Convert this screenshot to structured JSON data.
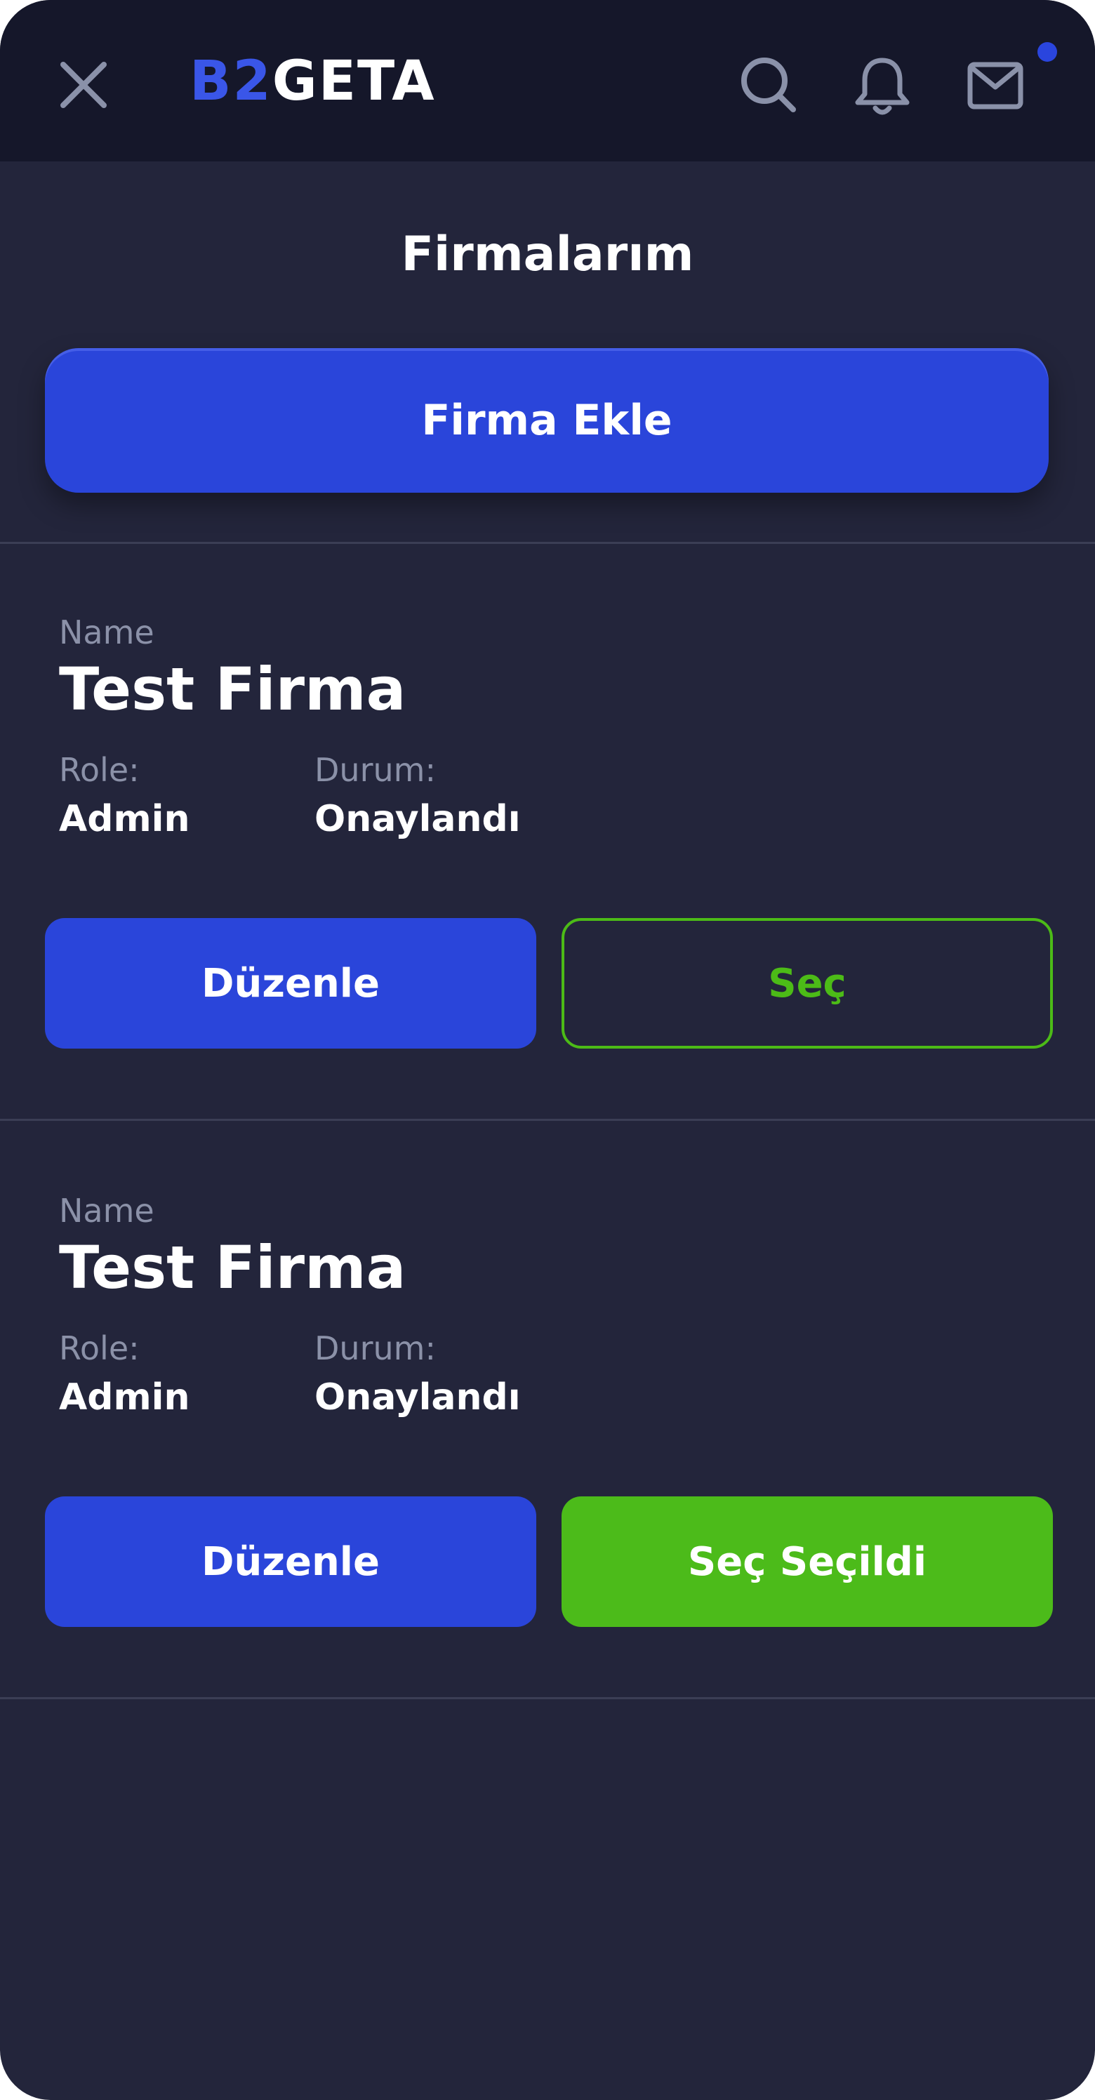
{
  "header": {
    "logo_accent": "B2",
    "logo_main": "GETA",
    "icons": [
      "close-icon",
      "search-icon",
      "bell-icon",
      "mail-icon"
    ]
  },
  "page": {
    "title": "Firmalarım",
    "add_button_label": "Firma Ekle"
  },
  "companies": [
    {
      "name_label": "Name",
      "name": "Test Firma",
      "role_label": "Role:",
      "role": "Admin",
      "status_label": "Durum:",
      "status": "Onaylandı",
      "edit_label": "Düzenle",
      "select_label": "Seç"
    },
    {
      "name_label": "Name",
      "name": "Test Firma",
      "role_label": "Role:",
      "role": "Admin",
      "status_label": "Durum:",
      "status": "Onaylandı",
      "edit_label": "Düzenle",
      "select_label": "Seç Seçildi"
    }
  ],
  "colors": {
    "background": "#23253b",
    "header": "#15172a",
    "primary": "#2a45da",
    "success": "#4cbb17",
    "muted_text": "#8b91a8"
  }
}
